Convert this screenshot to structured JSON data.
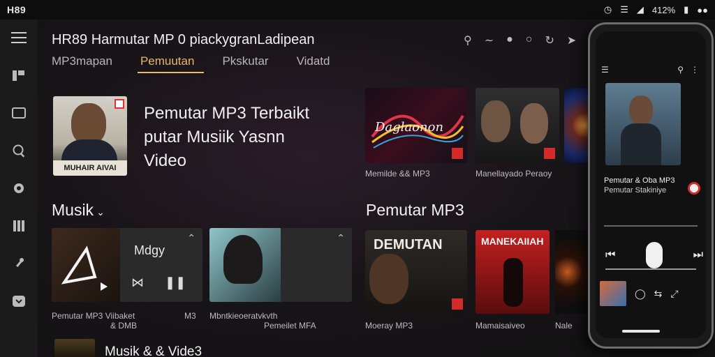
{
  "status": {
    "left": "H89",
    "battery_text": "412%"
  },
  "window": {
    "title": "HR89 Harmutar MP 0 piackygranLadipean"
  },
  "tabs": [
    {
      "label": "MP3mapan"
    },
    {
      "label": "Pemuutan",
      "active": true
    },
    {
      "label": "Pkskutar"
    },
    {
      "label": "Vidatd"
    }
  ],
  "hero": {
    "line1": "Pemutar MP3 Terbaikt",
    "line2": "putar Musiik Yasnn",
    "line3": "Video",
    "album_caption": "MUHAIR AIVAI"
  },
  "albums_top": [
    {
      "caption": "Memilde && MP3",
      "art_text": "Daglaonon"
    },
    {
      "caption": "Manellayado Peraoy",
      "art_text": ""
    }
  ],
  "sections": {
    "musik": "Musik",
    "pemutar": "Pemutar MP3",
    "musik_video": "Musik & & Vide3"
  },
  "player_cards": [
    {
      "title": "Mdgy",
      "caption_a": "Pemutar MP3 Viibaket",
      "caption_b": "& DMB",
      "tag": "M3"
    },
    {
      "title": "",
      "caption_a": "Mbntkieoeratvkvth",
      "caption_b": "Pemeilet MFA",
      "tag": ""
    }
  ],
  "albums_bottom": [
    {
      "caption": "Moeray MP3",
      "art_text": "DEMUTAN"
    },
    {
      "caption": "Mamaisaiveo",
      "art_text": "MANEKAIIAH"
    },
    {
      "caption": "Nale",
      "art_text": ""
    }
  ],
  "phone": {
    "track_title": "Pemutar & Oba MP3",
    "track_sub": "Pemutar Stakiniye"
  },
  "colors": {
    "accent": "#e8b66c",
    "red": "#d52a2a"
  }
}
